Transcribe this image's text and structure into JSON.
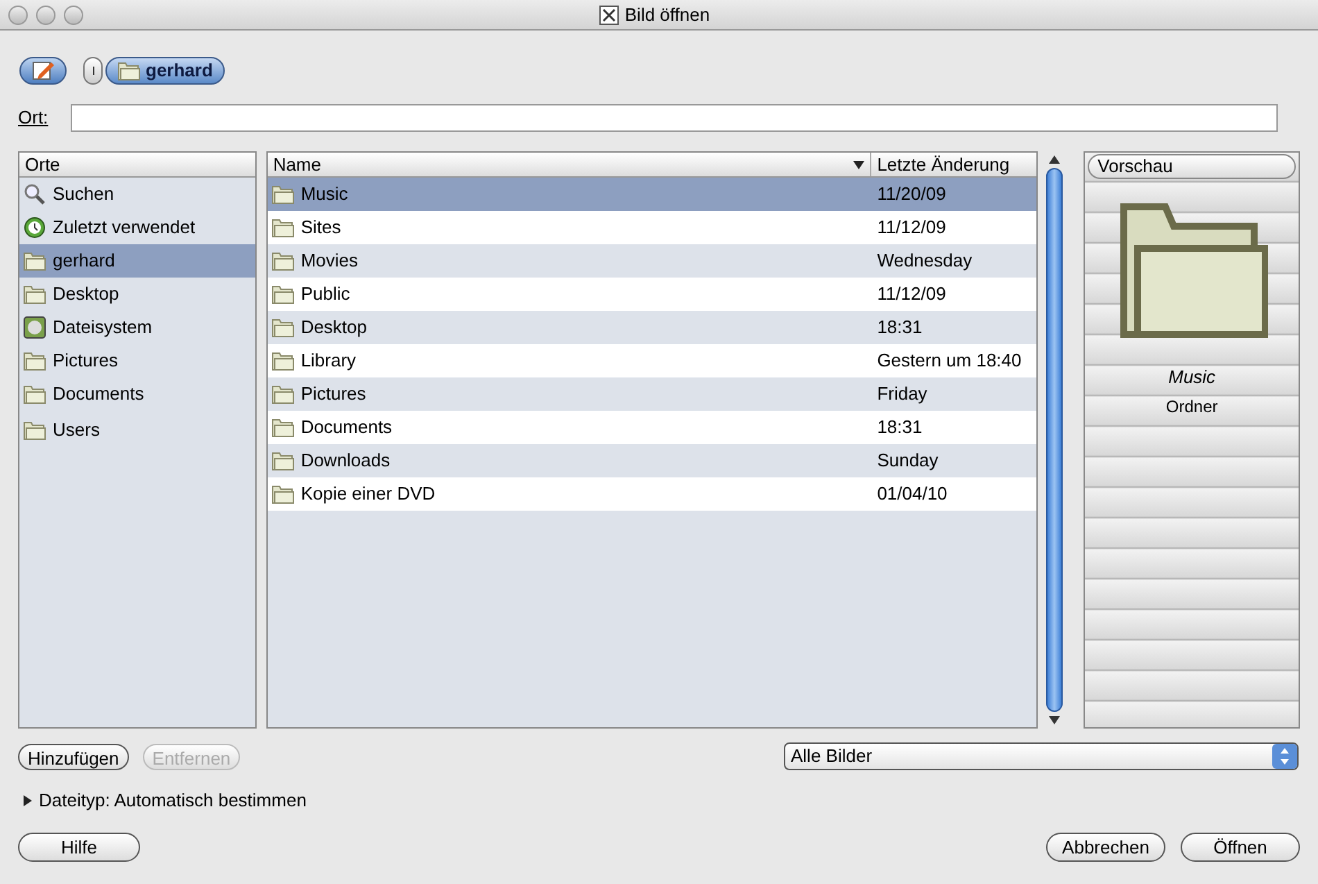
{
  "window": {
    "title": "Bild öffnen"
  },
  "path_bar": {
    "segments": [
      {
        "label": "gerhard",
        "selected": true
      }
    ]
  },
  "location": {
    "label": "Ort:"
  },
  "places": {
    "header": "Orte",
    "items": [
      {
        "label": "Suchen",
        "kind": "search",
        "selected": false
      },
      {
        "label": "Zuletzt verwendet",
        "kind": "recent",
        "selected": false
      },
      {
        "label": "gerhard",
        "kind": "folder",
        "selected": true
      },
      {
        "label": "Desktop",
        "kind": "folder",
        "selected": false
      },
      {
        "label": "Dateisystem",
        "kind": "drive",
        "selected": false
      },
      {
        "label": "Pictures",
        "kind": "folder",
        "selected": false
      },
      {
        "label": "Documents",
        "kind": "folder",
        "selected": false
      },
      {
        "label": "Users",
        "kind": "folder",
        "selected": false
      }
    ]
  },
  "files": {
    "columns": [
      "Name",
      "Letzte Änderung"
    ],
    "rows": [
      {
        "name": "Music",
        "modified": "11/20/09",
        "selected": true
      },
      {
        "name": "Sites",
        "modified": "11/12/09",
        "selected": false
      },
      {
        "name": "Movies",
        "modified": "Wednesday",
        "selected": false
      },
      {
        "name": "Public",
        "modified": "11/12/09",
        "selected": false
      },
      {
        "name": "Desktop",
        "modified": "18:31",
        "selected": false
      },
      {
        "name": "Library",
        "modified": "Gestern um 18:40",
        "selected": false
      },
      {
        "name": "Pictures",
        "modified": "Friday",
        "selected": false
      },
      {
        "name": "Documents",
        "modified": "18:31",
        "selected": false
      },
      {
        "name": "Downloads",
        "modified": "Sunday",
        "selected": false
      },
      {
        "name": "Kopie einer DVD",
        "modified": "01/04/10",
        "selected": false
      }
    ]
  },
  "preview": {
    "header": "Vorschau",
    "name": "Music",
    "type": "Ordner"
  },
  "buttons_left": [
    {
      "label": "Hinzufügen",
      "disabled": false
    },
    {
      "label": "Entfernen",
      "disabled": true
    }
  ],
  "filter": {
    "value": "Alle Bilder"
  },
  "file_type": {
    "label": "Dateityp: Automatisch bestimmen",
    "expanded": false
  },
  "help_button": "Hilfe",
  "actions": [
    "Abbrechen",
    "Öffnen"
  ]
}
